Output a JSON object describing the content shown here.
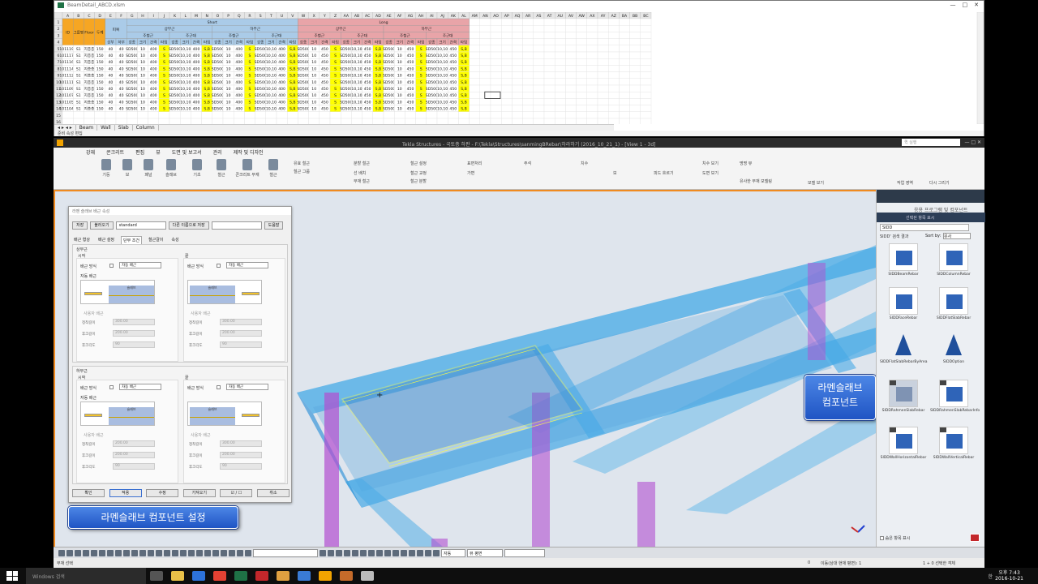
{
  "excel": {
    "title": "BeamDetail_ABCD.xlsm",
    "controls": [
      "—",
      "□",
      "✕"
    ],
    "columns": [
      "A",
      "B",
      "C",
      "D",
      "E",
      "F",
      "G",
      "H",
      "I",
      "J",
      "K",
      "L",
      "M",
      "N",
      "O",
      "P",
      "Q",
      "R",
      "S",
      "T",
      "U",
      "V",
      "W",
      "X",
      "Y",
      "Z",
      "AA",
      "AB",
      "AC",
      "AD",
      "AE",
      "AF",
      "AG",
      "AH",
      "AI",
      "AJ",
      "AK",
      "AL",
      "AM",
      "AN",
      "AO",
      "AP",
      "AQ",
      "AR",
      "AS",
      "AT",
      "AU",
      "AV",
      "AW",
      "AX",
      "AY",
      "AZ",
      "BA",
      "BB",
      "BC"
    ],
    "head_row": {
      "id": "ID",
      "group": "그룹명",
      "floor": "Floor",
      "thick": "두께",
      "cover": "피복",
      "short": "Short",
      "long": "Long"
    },
    "sub_head": {
      "upper": "상부근",
      "lower": "하부근",
      "main": "주철근",
      "dist": "주근대"
    },
    "cover_sub": [
      "상부",
      "하부"
    ],
    "field_labels": [
      "강종",
      "크기",
      "간격",
      "타입"
    ],
    "rows": [
      [
        "1011193",
        "S1",
        "지층층",
        "150",
        "40",
        "40"
      ],
      [
        "1011178",
        "S1",
        "지층층",
        "150",
        "40",
        "40"
      ],
      [
        "1011161",
        "S1",
        "지층층",
        "150",
        "40",
        "40"
      ],
      [
        "1011144",
        "S1",
        "지층층",
        "150",
        "40",
        "40"
      ],
      [
        "1011127",
        "S1",
        "지층층",
        "150",
        "40",
        "40"
      ],
      [
        "1011110",
        "S1",
        "지층층",
        "150",
        "40",
        "40"
      ],
      [
        "1011093",
        "S1",
        "지층층",
        "150",
        "40",
        "40"
      ],
      [
        "1011076",
        "S1",
        "지층층",
        "150",
        "40",
        "40"
      ],
      [
        "1011059",
        "S1",
        "지층층",
        "150",
        "40",
        "40"
      ],
      [
        "1011042",
        "S1",
        "지층층",
        "150",
        "40",
        "40"
      ]
    ],
    "rebar_vals": {
      "grade": "SD500",
      "size": "10",
      "size2": "10,10",
      "spacing_short": "400",
      "spacing_long": "450",
      "type_s": "S",
      "type_sb": "S,B"
    },
    "sheet_tabs": [
      "Beam",
      "Wall",
      "Slab",
      "Column"
    ],
    "status": "준비 속성 편집"
  },
  "tekla": {
    "title": "Tekla Structures - 국토층 하판 - F:\\Tekla\\Structures\\sanmingBRebar\\하라하기 (2016_10_21_1) - [View 1 - 3d]",
    "search_placeholder": "퀵 실행",
    "ribbon_tabs": [
      "강재",
      "콘크리트",
      "편집",
      "뷰",
      "도면 및 보고서",
      "관리",
      "제작 및 디자인"
    ],
    "ribbon_buttons": [
      "기둥",
      "보",
      "패널",
      "슬래브",
      "기초",
      "철근",
      "콘크리트 부재",
      "철근"
    ],
    "ribbon_small": [
      "유효 철근",
      "철근 그룹",
      "분할 철근",
      "선 배치",
      "부재 철근",
      "철근 설정",
      "철근 교정",
      "철근 분할",
      "표면처리",
      "가변",
      "주석",
      "치수",
      "보",
      "피드 흐르기",
      "치수 보기",
      "도면 보기",
      "명명 뷰",
      "유사한 부재 모델링",
      "모델 보기",
      "작업 영역",
      "다시 그리기"
    ]
  },
  "dialog": {
    "title": "라멘 슬래브 배근 속성",
    "buttons": [
      "저장",
      "불러오기"
    ],
    "preset": "standard",
    "save_as": "다른 이름으로 저장",
    "help": "도움말",
    "tabs": [
      "배근 형상",
      "배근 설정",
      "단부 조건",
      "철근갈이",
      "속성"
    ],
    "active_tab": "단부 조건",
    "upper_group": "상부근",
    "lower_group": "하부근",
    "start": "시작",
    "end": "끝",
    "hook_method": "배근 방식",
    "hook_value": "자동 배근",
    "hook_label": "자동 배근",
    "slab": "슬래브",
    "user_hook": "사용자 배근",
    "straight_len": "정착길이",
    "hook_len": "후크길이",
    "hook_angle": "후크각도",
    "val_300": "300.00",
    "val_200": "200.00",
    "val_90": "90",
    "footer": [
      "확인",
      "적용",
      "수정",
      "가져오기",
      "☑ / ☐",
      "취소"
    ]
  },
  "callouts": {
    "settings": "라멘슬래브 컴포넌트 설정",
    "component_line1": "라멘슬래브",
    "component_line2": "컴포넌트"
  },
  "rpanel": {
    "title": "응용 프로그램 및 컴포넌트",
    "subhead": "선택된 항목 표시",
    "search": "SIDD",
    "result": "SIDD' 검색 결과",
    "sort_label": "Sort by:",
    "sort_value": "유사",
    "items": [
      "SIDDBeamRebar",
      "SIDDColumnRebar",
      "SIDDFaceRebar",
      "SIDDFlatSlabRebar",
      "SIDDFlatSlabRebarByArea",
      "SIDDOption",
      "SIDDRahmenSlabRebar",
      "SIDDRahmenSlabRebarInfo",
      "SIDDWallHorizontalRebar",
      "SIDDWallVerticalRebar"
    ],
    "footer": "숨은 항목 표시"
  },
  "bottom": {
    "combo1": "자동",
    "combo2": "뷰 평면",
    "status_left": "부재 선택",
    "status_0": "0",
    "status_mid": "이동(상대 현재 평면): 1",
    "status_right": "1 + 0 선택한 객체"
  },
  "taskbar": {
    "search": "Windows 검색",
    "time": "오후 7:43",
    "date": "2016-10-21",
    "lang": "한"
  },
  "colors": {
    "orange_accent": "#f08a1f",
    "short_header": "#aacbe8",
    "long_header": "#e8a4a8",
    "yellow": "#ffff00",
    "callout_blue": "#2f6bd6",
    "beam_cyan": "#3fa9e6",
    "column_purple": "#b24fd0",
    "selection_yellow": "#ffff3c"
  }
}
